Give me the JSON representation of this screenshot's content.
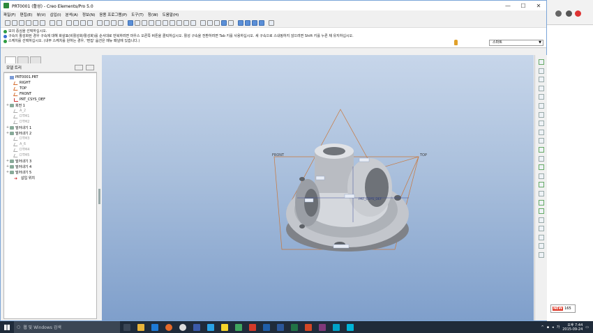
{
  "window": {
    "title": "PRT0001 (활성) - Creo Elements/Pro 5.0",
    "controls": [
      "—",
      "☐",
      "✕"
    ]
  },
  "menu": [
    "파일(F)",
    "편집(E)",
    "뷰(V)",
    "삽입(I)",
    "분석(A)",
    "정보(N)",
    "응용 프로그램(P)",
    "도구(T)",
    "창(W)",
    "도움말(H)"
  ],
  "messages": [
    "모의 중심을 선택하십시오.",
    "구속이 활성화된 경우 구속에 대해 화살표(비활성화/활성화)를 순서대로 반복하려면 마우스 오른쪽 버튼을 클릭하십시오. 활성 구속을 전환하려면 Tab 키를 사용하십시오. 새 구속으로 스내핑하지 않으려면 Shift 키를 누른 채 유지하십시오.",
    "스케치를 선택하십시오. (내부 스케치를 원하는 경우, '편집' 옵션은 메뉴 패널에 있습니다.)"
  ],
  "filter": {
    "value": "스마트"
  },
  "model_tree": {
    "header": "모델 트리",
    "items": [
      {
        "label": "PRT0001.PRT",
        "icon": "part-icon",
        "expand": "",
        "gray": false,
        "indent": 0
      },
      {
        "label": "RIGHT",
        "icon": "datum-plane-icon",
        "expand": "",
        "gray": false,
        "indent": 1
      },
      {
        "label": "TOP",
        "icon": "datum-plane-icon",
        "expand": "",
        "gray": false,
        "indent": 1
      },
      {
        "label": "FRONT",
        "icon": "datum-plane-icon",
        "expand": "",
        "gray": false,
        "indent": 1
      },
      {
        "label": "PRT_CSYS_DEF",
        "icon": "csys-icon",
        "expand": "",
        "gray": false,
        "indent": 1
      },
      {
        "label": "회전 1",
        "icon": "revolve-icon",
        "expand": "+",
        "gray": false,
        "indent": 0
      },
      {
        "label": "A_2",
        "icon": "datum-plane-icon",
        "expand": "",
        "gray": true,
        "indent": 1
      },
      {
        "label": "DTM1",
        "icon": "datum-plane-icon",
        "expand": "",
        "gray": true,
        "indent": 1
      },
      {
        "label": "DTM2",
        "icon": "datum-plane-icon",
        "expand": "",
        "gray": true,
        "indent": 1
      },
      {
        "label": "밀어내기 1",
        "icon": "extrude-icon",
        "expand": "+",
        "gray": false,
        "indent": 0
      },
      {
        "label": "밀어내기 2",
        "icon": "extrude-icon",
        "expand": "+",
        "gray": false,
        "indent": 0
      },
      {
        "label": "DTM3",
        "icon": "datum-plane-icon",
        "expand": "",
        "gray": true,
        "indent": 1
      },
      {
        "label": "A_6",
        "icon": "datum-plane-icon",
        "expand": "",
        "gray": true,
        "indent": 1
      },
      {
        "label": "DTM4",
        "icon": "datum-plane-icon",
        "expand": "",
        "gray": true,
        "indent": 1
      },
      {
        "label": "DTM5",
        "icon": "datum-plane-icon",
        "expand": "",
        "gray": true,
        "indent": 1
      },
      {
        "label": "밀어내기 3",
        "icon": "extrude-icon",
        "expand": "+",
        "gray": false,
        "indent": 0
      },
      {
        "label": "밀어내기 4",
        "icon": "extrude-icon",
        "expand": "+",
        "gray": false,
        "indent": 0
      },
      {
        "label": "밀어내기 5",
        "icon": "extrude-icon",
        "expand": "+",
        "gray": false,
        "indent": 0
      },
      {
        "label": "삽입 위치",
        "icon": "insert-here-icon",
        "expand": "",
        "gray": false,
        "indent": 1
      }
    ]
  },
  "graphics": {
    "datum_labels": {
      "front": "FRONT",
      "top": "TOP",
      "csys": "PRT_CSYS_DEF"
    },
    "colors": {
      "datum": "#d4823a",
      "part": "#b8bcc4",
      "bg_top": "#c7d6ea",
      "bg_bottom": "#7f9fcb"
    }
  },
  "taskbar": {
    "search_placeholder": "웹 및 Windows 검색",
    "time": "오후 7:44",
    "date": "2015-09-24"
  },
  "background_app": {
    "badge_new": "NEW",
    "badge_text": "165"
  }
}
